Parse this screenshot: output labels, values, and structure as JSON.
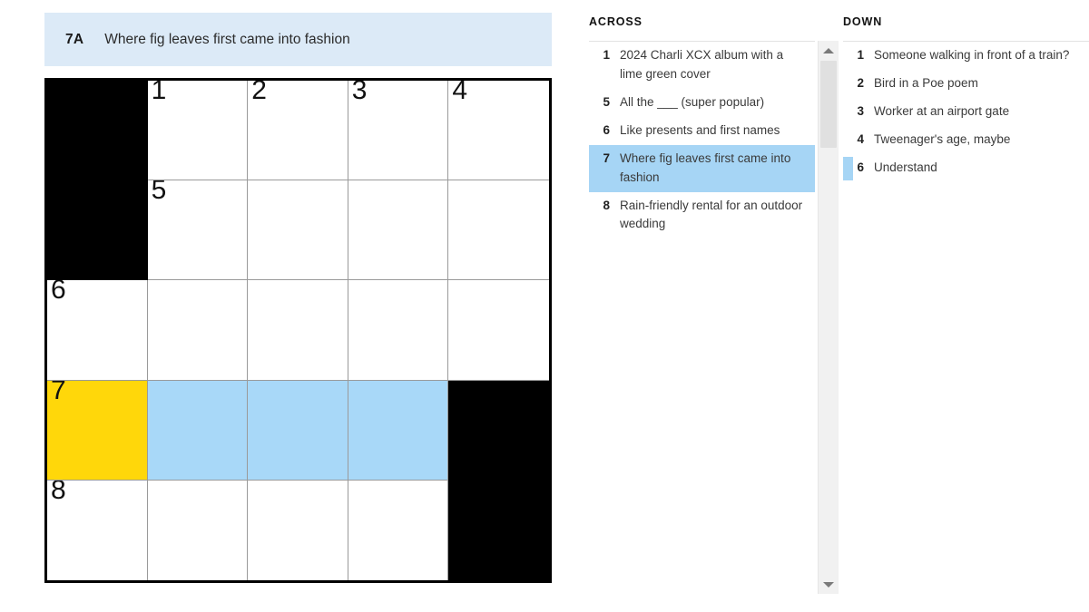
{
  "clue_bar": {
    "number": "7A",
    "text": "Where fig leaves first came into fashion"
  },
  "grid": {
    "rows": 5,
    "cols": 5,
    "colors": {
      "block": "#000000",
      "cell": "#ffffff",
      "highlight": "#a8d8f8",
      "cursor": "#ffd70a",
      "border": "#000000",
      "gridline": "#9a9a9a"
    },
    "cells": [
      [
        {
          "type": "block"
        },
        {
          "type": "open",
          "number": "1",
          "letter": ""
        },
        {
          "type": "open",
          "number": "2",
          "letter": ""
        },
        {
          "type": "open",
          "number": "3",
          "letter": ""
        },
        {
          "type": "open",
          "number": "4",
          "letter": ""
        }
      ],
      [
        {
          "type": "block"
        },
        {
          "type": "open",
          "number": "5",
          "letter": ""
        },
        {
          "type": "open",
          "number": "",
          "letter": ""
        },
        {
          "type": "open",
          "number": "",
          "letter": ""
        },
        {
          "type": "open",
          "number": "",
          "letter": ""
        }
      ],
      [
        {
          "type": "open",
          "number": "6",
          "letter": ""
        },
        {
          "type": "open",
          "number": "",
          "letter": ""
        },
        {
          "type": "open",
          "number": "",
          "letter": ""
        },
        {
          "type": "open",
          "number": "",
          "letter": ""
        },
        {
          "type": "open",
          "number": "",
          "letter": ""
        }
      ],
      [
        {
          "type": "open",
          "number": "7",
          "letter": "",
          "state": "cursor"
        },
        {
          "type": "open",
          "number": "",
          "letter": "",
          "state": "highlight"
        },
        {
          "type": "open",
          "number": "",
          "letter": "",
          "state": "highlight"
        },
        {
          "type": "open",
          "number": "",
          "letter": "",
          "state": "highlight"
        },
        {
          "type": "block"
        }
      ],
      [
        {
          "type": "open",
          "number": "8",
          "letter": ""
        },
        {
          "type": "open",
          "number": "",
          "letter": ""
        },
        {
          "type": "open",
          "number": "",
          "letter": ""
        },
        {
          "type": "open",
          "number": "",
          "letter": ""
        },
        {
          "type": "block"
        }
      ]
    ]
  },
  "across": {
    "heading": "ACROSS",
    "clues": [
      {
        "number": "1",
        "text": "2024 Charli XCX album with a lime green cover",
        "active": false,
        "marker": false
      },
      {
        "number": "5",
        "text": "All the ___ (super popular)",
        "active": false,
        "marker": false
      },
      {
        "number": "6",
        "text": "Like presents and first names",
        "active": false,
        "marker": false
      },
      {
        "number": "7",
        "text": "Where fig leaves first came into fashion",
        "active": true,
        "marker": false
      },
      {
        "number": "8",
        "text": "Rain-friendly rental for an outdoor wedding",
        "active": false,
        "marker": false
      }
    ],
    "scrollbar": {
      "up_icon": "triangle-up-icon",
      "down_icon": "triangle-down-icon"
    }
  },
  "down": {
    "heading": "DOWN",
    "clues": [
      {
        "number": "1",
        "text": "Someone walking in front of a train?",
        "active": false,
        "marker": false
      },
      {
        "number": "2",
        "text": "Bird in a Poe poem",
        "active": false,
        "marker": false
      },
      {
        "number": "3",
        "text": "Worker at an airport gate",
        "active": false,
        "marker": false
      },
      {
        "number": "4",
        "text": "Tweenager's age, maybe",
        "active": false,
        "marker": false
      },
      {
        "number": "6",
        "text": "Understand",
        "active": false,
        "marker": true
      }
    ]
  }
}
